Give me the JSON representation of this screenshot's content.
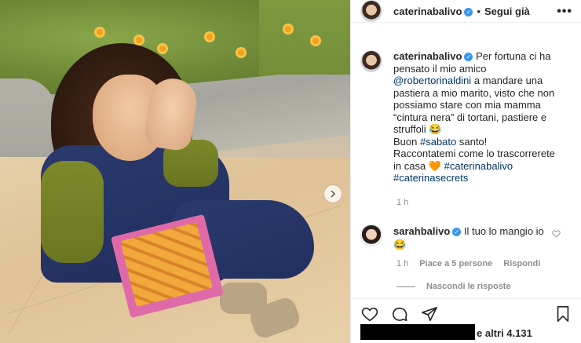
{
  "post": {
    "username": "caterinabalivo",
    "follow_label": "Segui già",
    "more_label": "•••",
    "verified_mark": "✓"
  },
  "caption": {
    "username": "caterinabalivo",
    "line1": "Per fortuna ci ha",
    "line2": "pensato il mio amico",
    "mention": "@robertorinaldini",
    "line3_rest": " a mandare una",
    "line4": "pastiera a mio marito, visto che non",
    "line5": "possiamo stare con mia mamma",
    "line6": "“cintura nera” di tortani, pastiere e",
    "line7": "struffoli 😂",
    "line8_prefix": "Buon ",
    "hashtag_sabato": "#sabato",
    "line8_suffix": " santo!",
    "line9": "Raccontatemi come lo trascorrerete",
    "line10_prefix": "in casa 🧡 ",
    "hashtag_caterinabalivo": "#caterinabalivo",
    "hashtag_caterinasecrets": "#caterinasecrets",
    "time": "1 h"
  },
  "comment": {
    "username": "sarahbalivo",
    "text": "Il tuo lo mangio io",
    "emoji": "😂",
    "time": "1 h",
    "likes": "Piace a 5 persone",
    "reply_label": "Rispondi",
    "hide_replies": "Nascondi le risposte"
  },
  "footer": {
    "likes_text": "e altri 4.131"
  },
  "icons": {
    "heart": "heart-icon",
    "comment": "comment-icon",
    "share": "share-icon",
    "bookmark": "bookmark-icon",
    "next": "chevron-right-icon"
  }
}
